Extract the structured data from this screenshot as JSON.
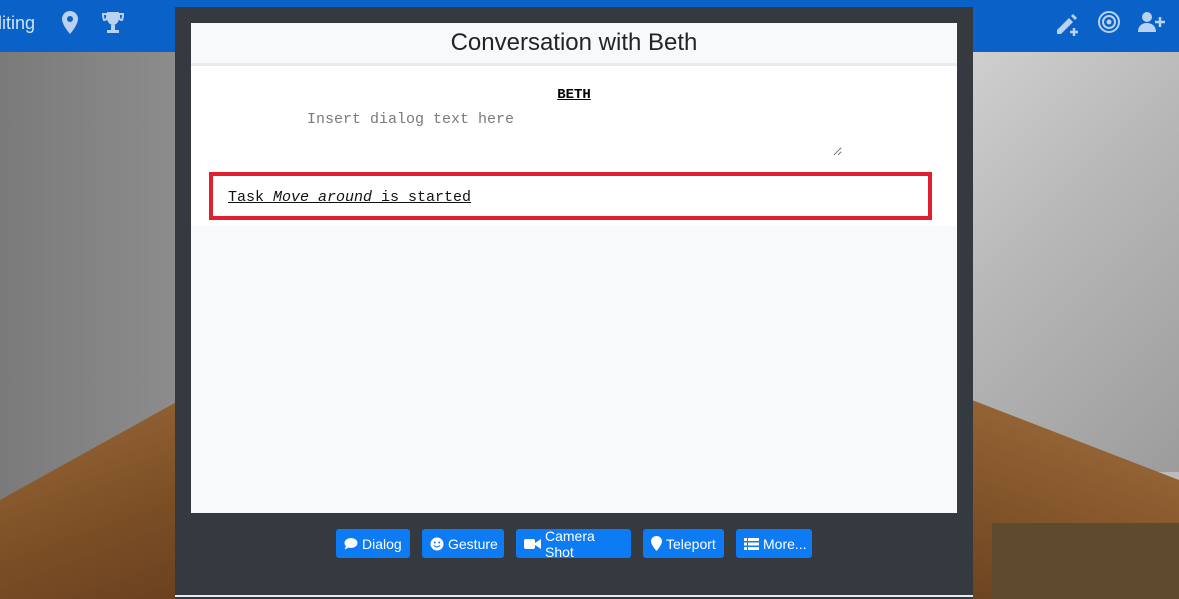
{
  "nav": {
    "left_text": "diting",
    "icons": [
      "map-pin-icon",
      "trophy-icon",
      "edit-add-icon",
      "target-icon",
      "add-user-icon"
    ],
    "color": "#0a62c9"
  },
  "modal": {
    "title": "Conversation with Beth",
    "speaker": "BETH",
    "dialog_placeholder": "Insert dialog text here",
    "dialog_value": "",
    "task": {
      "prefix": "Task ",
      "name": "Move around",
      "suffix": " is started",
      "highlight_color": "#e0202f"
    }
  },
  "actions": [
    {
      "label": "Dialog",
      "icon": "speech-bubble-icon"
    },
    {
      "label": "Gesture",
      "icon": "smiley-icon"
    },
    {
      "label": "Camera Shot",
      "icon": "video-camera-icon"
    },
    {
      "label": "Teleport",
      "icon": "map-marker-icon"
    },
    {
      "label": "More...",
      "icon": "list-icon"
    }
  ],
  "colors": {
    "button": "#0d7bf3",
    "modal_bg": "#343a40"
  }
}
